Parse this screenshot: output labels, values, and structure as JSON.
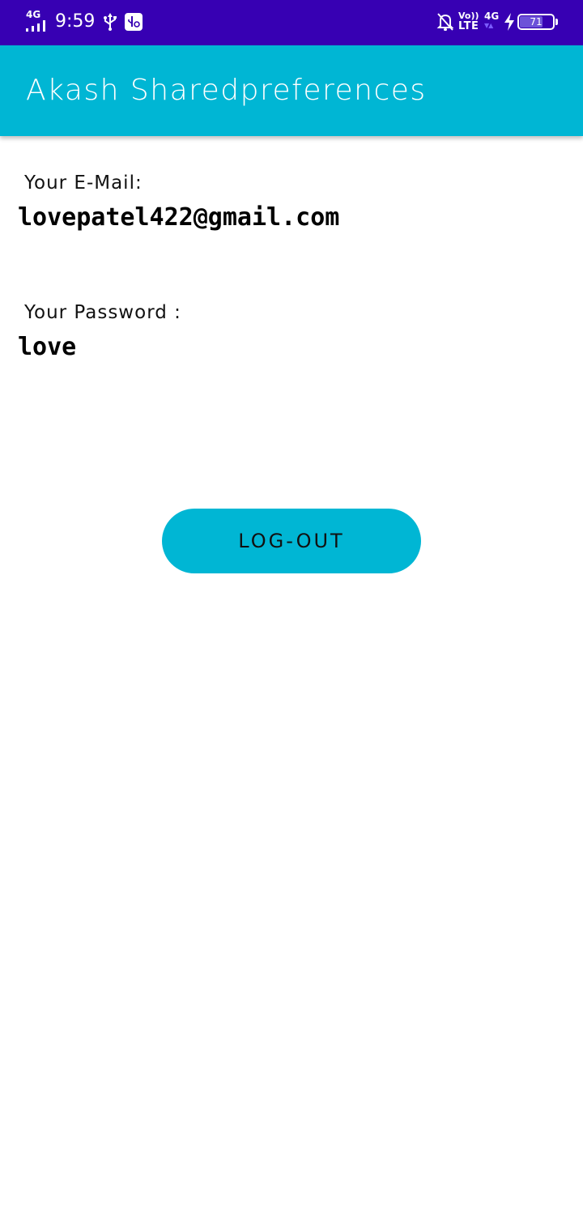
{
  "status_bar": {
    "network_type": "4G",
    "time": "9:59",
    "volte_top": "Vo))",
    "volte_bottom": "LTE",
    "data_type": "4G",
    "data_arrows": "▼▲",
    "battery_level": "71",
    "battery_fraction": 0.71,
    "icons": [
      "signal-icon",
      "usb-icon",
      "usb-debugging-icon",
      "notifications-muted-icon",
      "volte-icon",
      "mobile-data-icon",
      "charging-bolt-icon",
      "battery-icon"
    ]
  },
  "app_bar": {
    "title": "Akash Sharedpreferences"
  },
  "main": {
    "email_label": "Your E-Mail:",
    "email_value": "lovepatel422@gmail.com",
    "password_label": "Your Password :",
    "password_value": "love",
    "logout_label": "LOG-OUT"
  },
  "colors": {
    "status_bar": "#3700b3",
    "primary": "#00b6d4",
    "background": "#ffffff",
    "text": "#000000"
  }
}
